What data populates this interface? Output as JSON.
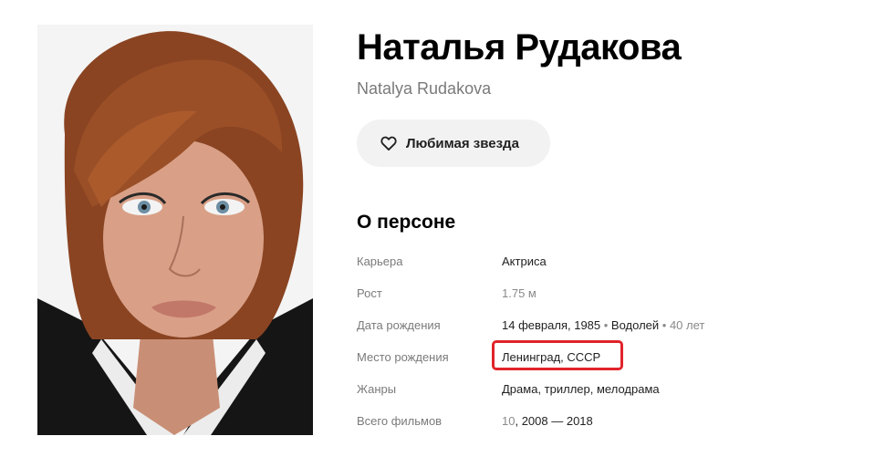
{
  "person": {
    "name": "Наталья Рудакова",
    "original_name": "Natalya Rudakova"
  },
  "favorite_button": {
    "label": "Любимая звезда",
    "icon": "heart-outline-icon"
  },
  "about": {
    "title": "О персоне",
    "career": {
      "label": "Карьера",
      "value": "Актриса"
    },
    "height": {
      "label": "Рост",
      "value": "1.75 м"
    },
    "birth_date": {
      "label": "Дата рождения",
      "date": "14 февраля, 1985",
      "sep1": " • ",
      "zodiac": "Водолей",
      "sep2": " • ",
      "age": "40 лет"
    },
    "birth_place": {
      "label": "Место рождения",
      "value": "Ленинград, СССР"
    },
    "genres": {
      "label": "Жанры",
      "g1": "Драма",
      "c1": ", ",
      "g2": "триллер",
      "c2": ", ",
      "g3": "мелодрама"
    },
    "films_total": {
      "label": "Всего фильмов",
      "count": "10",
      "sep": ", ",
      "years": "2008 — 2018"
    }
  },
  "colors": {
    "highlight": "#e0242a",
    "button_bg": "#f2f2f2",
    "muted_text": "#7a7a7a"
  }
}
